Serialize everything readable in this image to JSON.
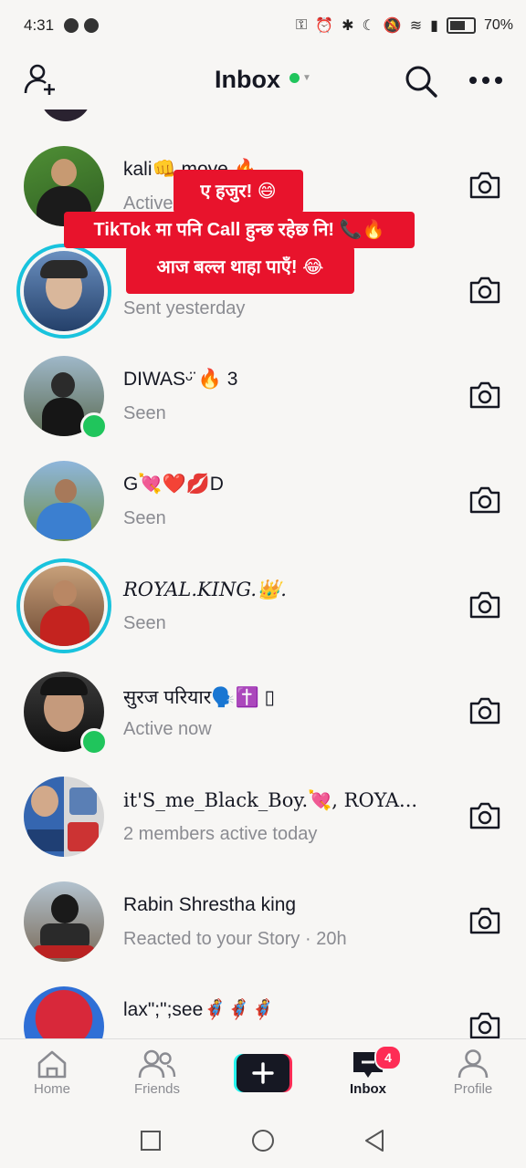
{
  "status_bar": {
    "time": "4:31",
    "battery": "70%"
  },
  "header": {
    "title": "Inbox"
  },
  "overlay": {
    "line1": "ए हजुर! 😄",
    "line2": "TikTok मा पनि Call हुन्छ रहेछ नि! 📞🔥",
    "line3": "आज बल्ल थाहा पाएँ! 😂"
  },
  "conversations": [
    {
      "name": "kali👊 moye 🔥",
      "subtitle": "Active now"
    },
    {
      "name": "",
      "subtitle": "Sent yesterday"
    },
    {
      "name": "DIWASᵕ̈ 🔥 3",
      "subtitle": "Seen"
    },
    {
      "name": "G💘❤️💋D",
      "subtitle": "Seen"
    },
    {
      "name": "ROYAL.KING.👑.",
      "subtitle": "Seen"
    },
    {
      "name": "सुरज परियार🗣️✝️ ▯",
      "subtitle": "Active now"
    },
    {
      "name": "it'S_me_Black_Boy.💘, ROYA...",
      "subtitle": "2 members active today"
    },
    {
      "name": "Rabin Shrestha king",
      "subtitle": "Reacted to your Story · 20h"
    },
    {
      "name": "lax\";\";see🦸🦸🦸",
      "subtitle": ""
    }
  ],
  "tabbar": {
    "home": "Home",
    "friends": "Friends",
    "inbox": "Inbox",
    "inbox_badge": "4",
    "profile": "Profile"
  },
  "colors": {
    "accent": "#fe2c55",
    "online": "#20c55c",
    "story_ring": "#19c3dd",
    "overlay_red": "#e8132c"
  }
}
